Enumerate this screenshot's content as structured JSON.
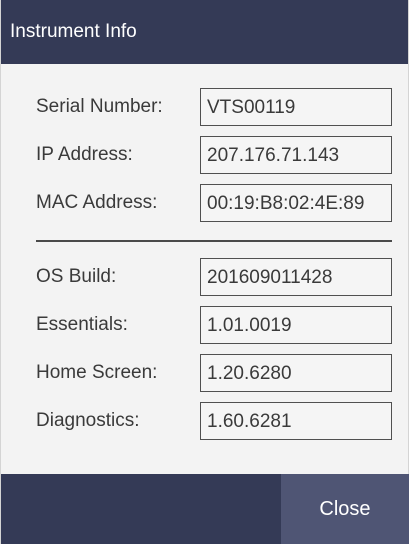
{
  "dialog": {
    "title": "Instrument Info",
    "close_label": "Close"
  },
  "network_info": [
    {
      "label": "Serial Number:",
      "value": "VTS00119"
    },
    {
      "label": "IP Address:",
      "value": "207.176.71.143"
    },
    {
      "label": "MAC Address:",
      "value": "00:19:B8:02:4E:89"
    }
  ],
  "software_info": [
    {
      "label": "OS Build:",
      "value": "201609011428"
    },
    {
      "label": "Essentials:",
      "value": "1.01.0019"
    },
    {
      "label": "Home Screen:",
      "value": "1.20.6280"
    },
    {
      "label": "Diagnostics:",
      "value": "1.60.6281"
    }
  ],
  "colors": {
    "header_bg": "#343a56",
    "button_bg": "#4f5574",
    "content_bg": "#f3f3f3"
  }
}
